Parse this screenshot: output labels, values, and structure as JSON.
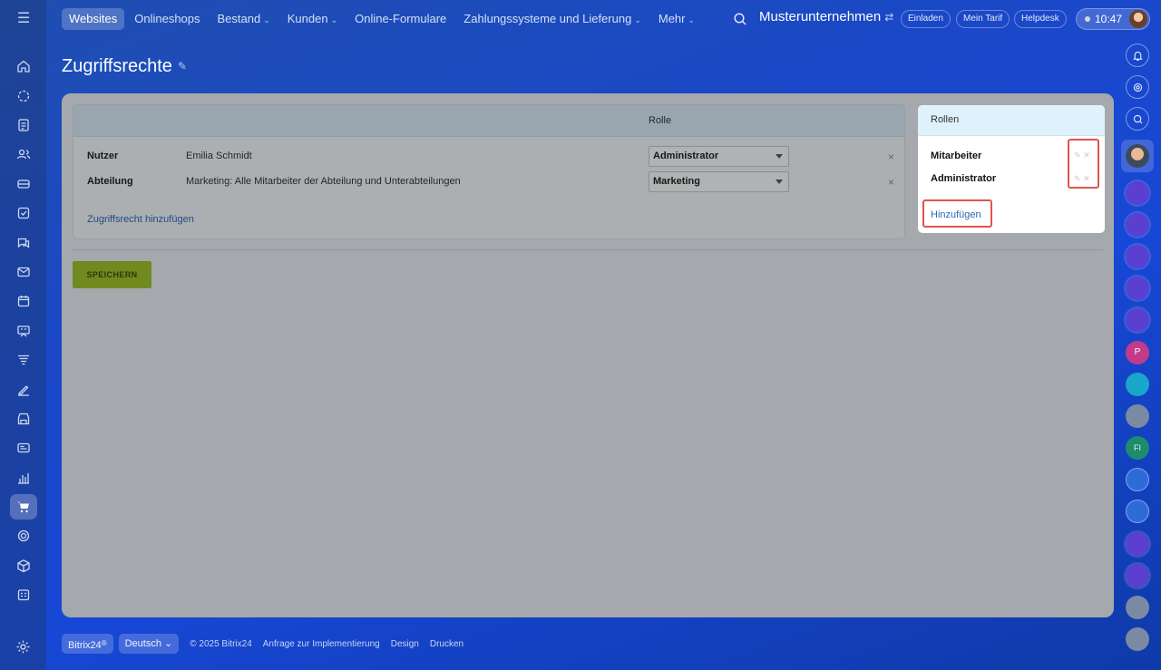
{
  "nav": {
    "items": [
      {
        "label": "Websites",
        "dropdown": false,
        "active": true
      },
      {
        "label": "Onlineshops",
        "dropdown": false,
        "active": false
      },
      {
        "label": "Bestand",
        "dropdown": true,
        "active": false
      },
      {
        "label": "Kunden",
        "dropdown": true,
        "active": false
      },
      {
        "label": "Online-Formulare",
        "dropdown": false,
        "active": false
      },
      {
        "label": "Zahlungssysteme und Lieferung",
        "dropdown": true,
        "active": false
      },
      {
        "label": "Mehr",
        "dropdown": true,
        "active": false
      }
    ]
  },
  "header": {
    "company": "Musterunternehmen",
    "invite": "Einladen",
    "tariff": "Mein Tarif",
    "helpdesk": "Helpdesk",
    "time": "10:47"
  },
  "page": {
    "title": "Zugriffsrechte"
  },
  "permissions": {
    "column_role": "Rolle",
    "rows": [
      {
        "label": "Nutzer",
        "value": "Emilia Schmidt",
        "role": "Administrator"
      },
      {
        "label": "Abteilung",
        "value": "Marketing: Alle Mitarbeiter der Abteilung und Unterabteilungen",
        "role": "Marketing"
      }
    ],
    "add_link": "Zugriffsrecht hinzufügen",
    "save_label": "SPEICHERN"
  },
  "roles": {
    "title": "Rollen",
    "items": [
      "Mitarbeiter",
      "Administrator"
    ],
    "add_label": "Hinzufügen"
  },
  "footer": {
    "brand": "Bitrix24",
    "language": "Deutsch",
    "copyright": "© 2025 Bitrix24",
    "links": [
      "Anfrage zur Implementierung",
      "Design",
      "Drucken"
    ]
  },
  "colors": {
    "accent_green": "#98bb2a",
    "highlight_red": "#e0544f",
    "link_blue": "#2a68b2"
  },
  "icons": {
    "left_sidebar": [
      "home-icon",
      "feed-icon",
      "tasks-icon",
      "contacts-icon",
      "crm-icon",
      "checklist-icon",
      "chat-icon",
      "mail-icon",
      "calendar-icon",
      "board-icon",
      "funnel-icon",
      "sign-icon",
      "store-icon",
      "cards-icon",
      "analytics-icon",
      "shop-cart-icon",
      "target-icon",
      "box-icon",
      "planner-icon",
      "settings-icon"
    ],
    "right_bar": [
      "bell-icon",
      "copilot-icon",
      "search-chat-icon"
    ]
  }
}
